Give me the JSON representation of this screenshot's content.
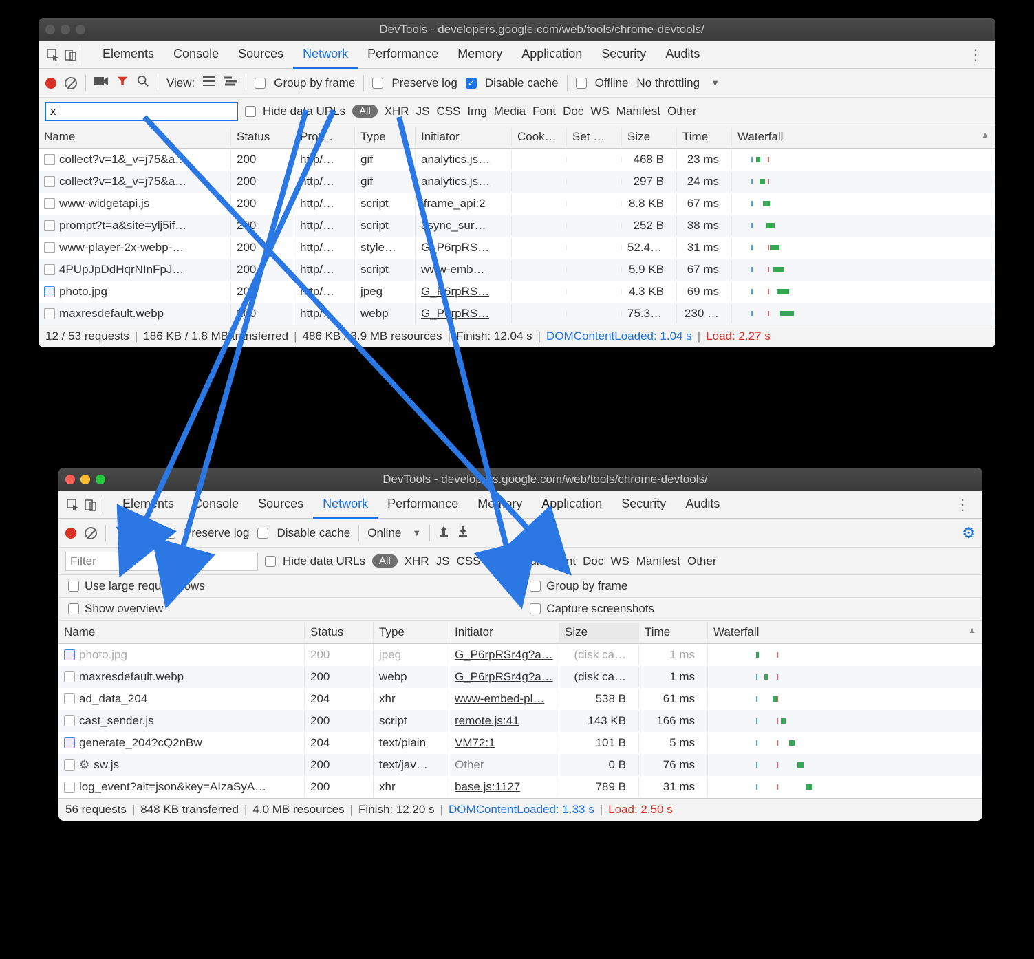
{
  "window1": {
    "title": "DevTools - developers.google.com/web/tools/chrome-devtools/",
    "tabs": [
      "Elements",
      "Console",
      "Sources",
      "Network",
      "Performance",
      "Memory",
      "Application",
      "Security",
      "Audits"
    ],
    "active_tab": "Network",
    "toolbar": {
      "view_label": "View:",
      "group_by_frame": "Group by frame",
      "preserve_log": "Preserve log",
      "disable_cache": "Disable cache",
      "offline": "Offline",
      "throttling": "No throttling"
    },
    "filter": {
      "value": "x",
      "hide_data_urls": "Hide data URLs",
      "all": "All",
      "types": [
        "XHR",
        "JS",
        "CSS",
        "Img",
        "Media",
        "Font",
        "Doc",
        "WS",
        "Manifest",
        "Other"
      ]
    },
    "columns": [
      "Name",
      "Status",
      "Prot…",
      "Type",
      "Initiator",
      "Cook…",
      "Set …",
      "Size",
      "Time",
      "Waterfall"
    ],
    "rows": [
      {
        "name": "collect?v=1&_v=j75&a…",
        "status": "200",
        "proto": "http/…",
        "type": "gif",
        "init": "analytics.js…",
        "cook": "",
        "set": "",
        "size": "468 B",
        "time": "23 ms"
      },
      {
        "name": "collect?v=1&_v=j75&a…",
        "status": "200",
        "proto": "http/…",
        "type": "gif",
        "init": "analytics.js…",
        "cook": "",
        "set": "",
        "size": "297 B",
        "time": "24 ms"
      },
      {
        "name": "www-widgetapi.js",
        "status": "200",
        "proto": "http/…",
        "type": "script",
        "init": "iframe_api:2",
        "cook": "",
        "set": "",
        "size": "8.8 KB",
        "time": "67 ms"
      },
      {
        "name": "prompt?t=a&site=ylj5if…",
        "status": "200",
        "proto": "http/…",
        "type": "script",
        "init": "async_sur…",
        "cook": "",
        "set": "",
        "size": "252 B",
        "time": "38 ms"
      },
      {
        "name": "www-player-2x-webp-…",
        "status": "200",
        "proto": "http/…",
        "type": "style…",
        "init": "G_P6rpRS…",
        "cook": "",
        "set": "",
        "size": "52.4 …",
        "time": "31 ms"
      },
      {
        "name": "4PUpJpDdHqrNInFpJ…",
        "status": "200",
        "proto": "http/…",
        "type": "script",
        "init": "www-emb…",
        "cook": "",
        "set": "",
        "size": "5.9 KB",
        "time": "67 ms"
      },
      {
        "name": "photo.jpg",
        "status": "200",
        "proto": "http/…",
        "type": "jpeg",
        "init": "G_P6rpRS…",
        "cook": "",
        "set": "",
        "size": "4.3 KB",
        "time": "69 ms",
        "icon": "img"
      },
      {
        "name": "maxresdefault.webp",
        "status": "200",
        "proto": "http/…",
        "type": "webp",
        "init": "G_P6rpRS…",
        "cook": "",
        "set": "",
        "size": "75.3 …",
        "time": "230 …"
      }
    ],
    "status": {
      "requests": "12 / 53 requests",
      "transferred": "186 KB / 1.8 MB transferred",
      "resources": "486 KB / 3.9 MB resources",
      "finish": "Finish: 12.04 s",
      "dcl": "DOMContentLoaded: 1.04 s",
      "load": "Load: 2.27 s"
    }
  },
  "window2": {
    "title": "DevTools - developers.google.com/web/tools/chrome-devtools/",
    "tabs": [
      "Elements",
      "Console",
      "Sources",
      "Network",
      "Performance",
      "Memory",
      "Application",
      "Security",
      "Audits"
    ],
    "active_tab": "Network",
    "toolbar": {
      "preserve_log": "Preserve log",
      "disable_cache": "Disable cache",
      "online": "Online"
    },
    "filter": {
      "placeholder": "Filter",
      "hide_data_urls": "Hide data URLs",
      "all": "All",
      "types": [
        "XHR",
        "JS",
        "CSS",
        "Img",
        "Media",
        "Font",
        "Doc",
        "WS",
        "Manifest",
        "Other"
      ]
    },
    "settings": {
      "large_rows": "Use large request rows",
      "group_frame": "Group by frame",
      "show_overview": "Show overview",
      "capture": "Capture screenshots"
    },
    "columns": [
      "Name",
      "Status",
      "Type",
      "Initiator",
      "Size",
      "Time",
      "Waterfall"
    ],
    "rows": [
      {
        "name": "photo.jpg",
        "status": "200",
        "type": "jpeg",
        "init": "G_P6rpRSr4g?a…",
        "size": "(disk ca…",
        "time": "1 ms",
        "faded": true,
        "icon": "img"
      },
      {
        "name": "maxresdefault.webp",
        "status": "200",
        "type": "webp",
        "init": "G_P6rpRSr4g?a…",
        "size": "(disk ca…",
        "time": "1 ms"
      },
      {
        "name": "ad_data_204",
        "status": "204",
        "type": "xhr",
        "init": "www-embed-pl…",
        "size": "538 B",
        "time": "61 ms"
      },
      {
        "name": "cast_sender.js",
        "status": "200",
        "type": "script",
        "init": "remote.js:41",
        "size": "143 KB",
        "time": "166 ms"
      },
      {
        "name": "generate_204?cQ2nBw",
        "status": "204",
        "type": "text/plain",
        "init": "VM72:1",
        "size": "101 B",
        "time": "5 ms",
        "icon": "img"
      },
      {
        "name": "sw.js",
        "status": "200",
        "type": "text/jav…",
        "init": "Other",
        "size": "0 B",
        "time": "76 ms",
        "gear": true,
        "nolink": true
      },
      {
        "name": "log_event?alt=json&key=AIzaSyA…",
        "status": "200",
        "type": "xhr",
        "init": "base.js:1127",
        "size": "789 B",
        "time": "31 ms"
      }
    ],
    "status": {
      "requests": "56 requests",
      "transferred": "848 KB transferred",
      "resources": "4.0 MB resources",
      "finish": "Finish: 12.20 s",
      "dcl": "DOMContentLoaded: 1.33 s",
      "load": "Load: 2.50 s"
    }
  }
}
